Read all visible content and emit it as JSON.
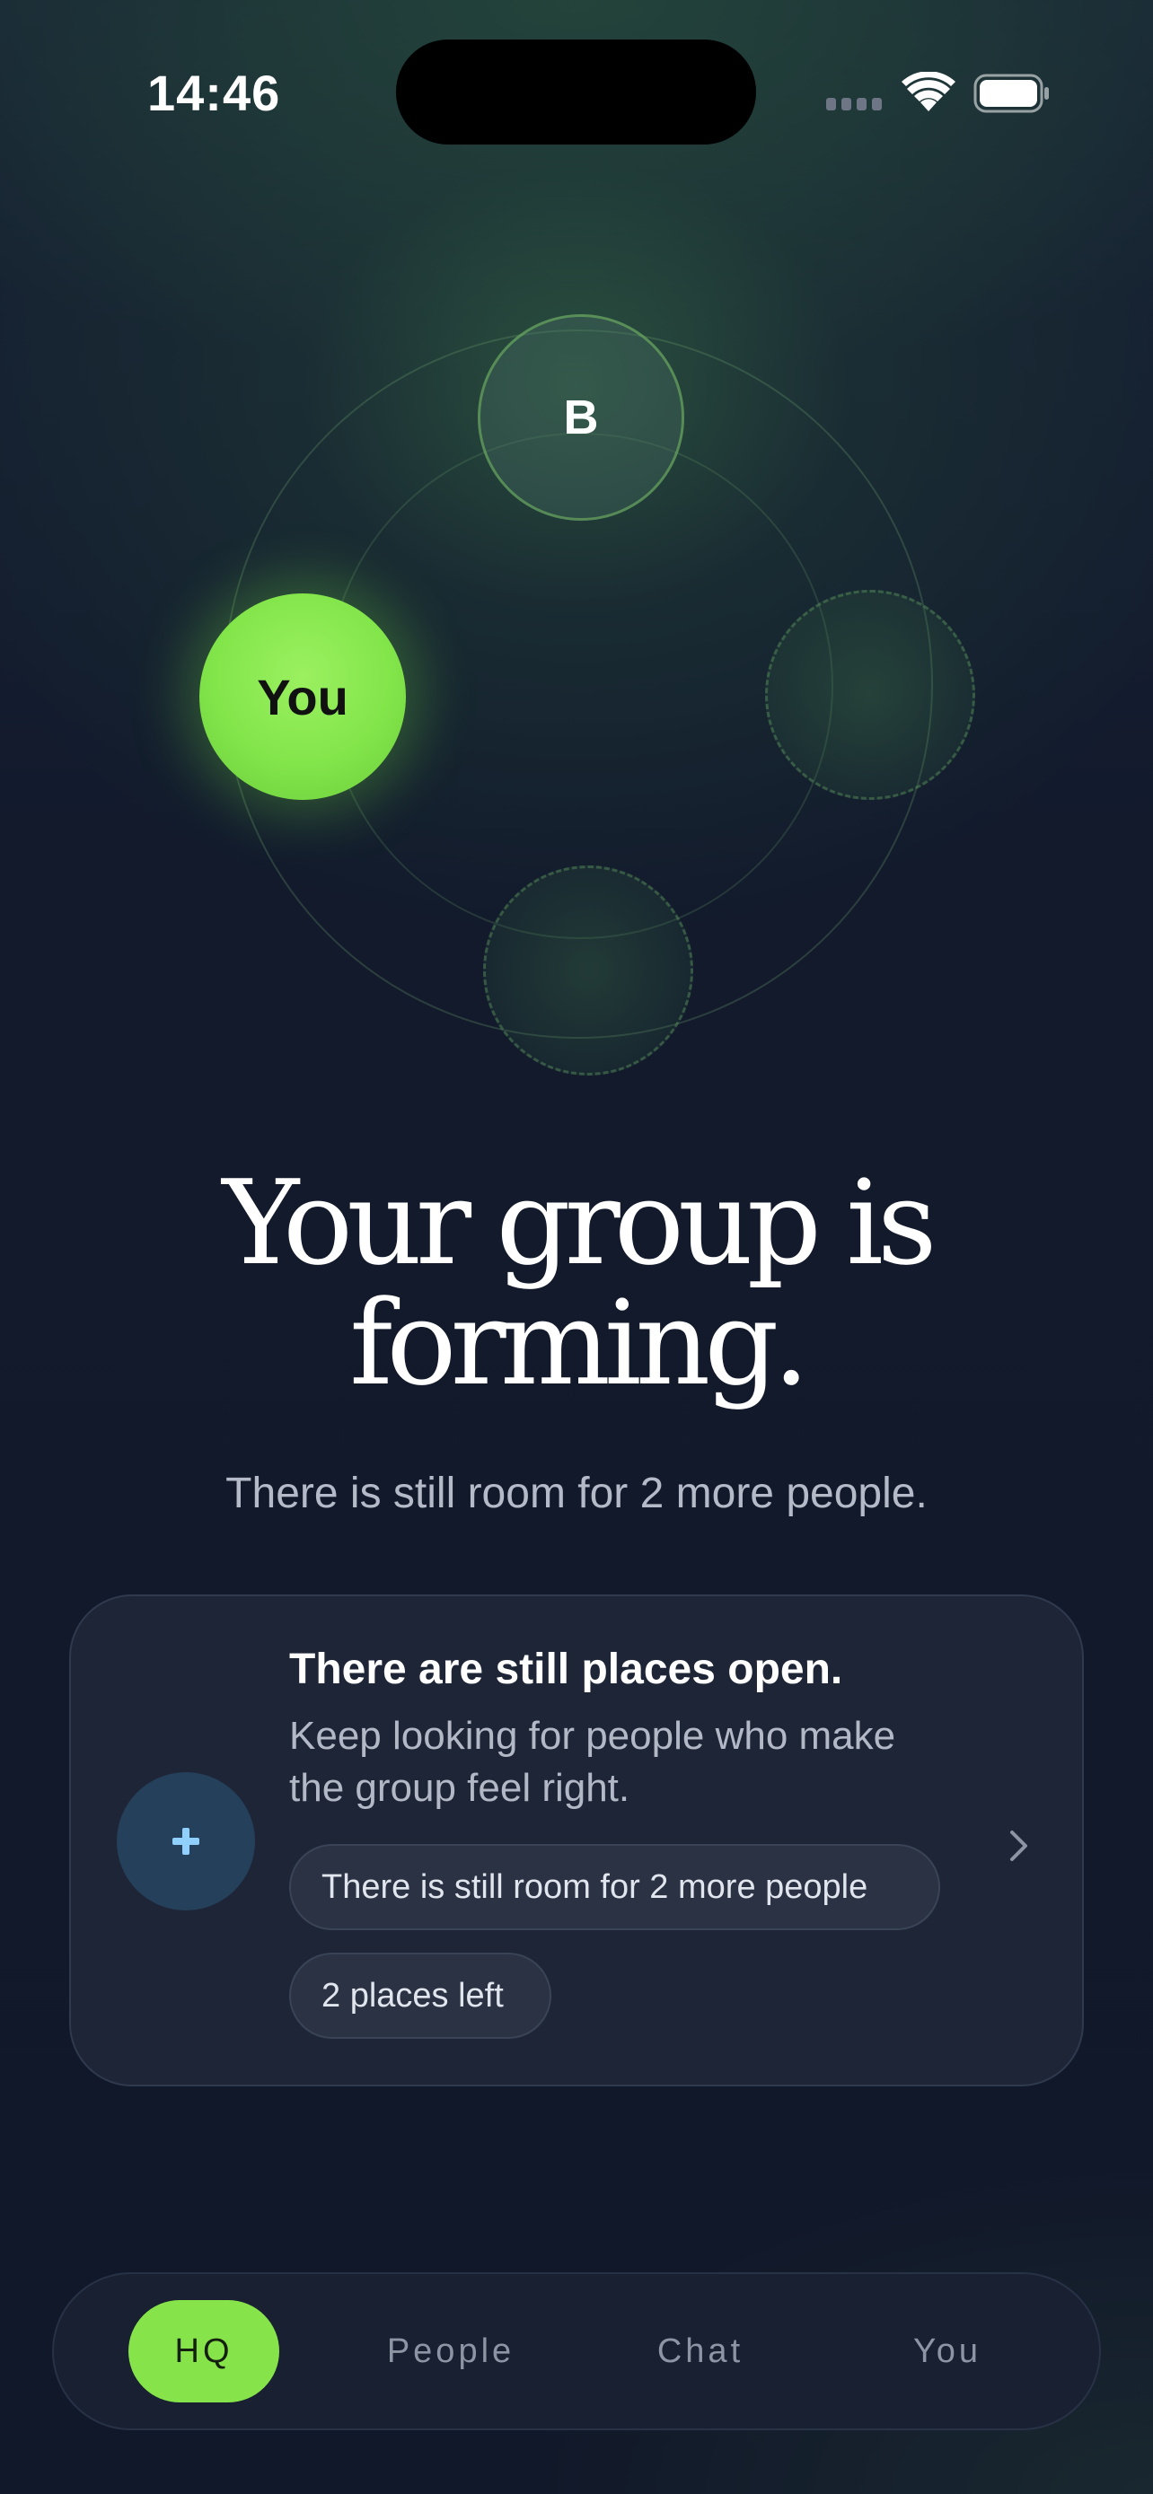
{
  "status_bar": {
    "time": "14:46",
    "icons": [
      "signal-icon",
      "wifi-icon",
      "battery-icon"
    ]
  },
  "group": {
    "members": [
      {
        "label": "B",
        "color": "#4b7a5c"
      },
      {
        "label": "You",
        "color": "#86e44a"
      }
    ],
    "open_slots": 2
  },
  "main": {
    "headline_line1": "Your group is",
    "headline_line2": "forming.",
    "subtitle": "There is still room for 2 more people."
  },
  "card": {
    "icon": "plus-icon",
    "title": "There are still places open.",
    "body": "Keep looking for people who make the group feel right.",
    "chips": [
      "There is still room for 2 more people",
      "2 places left"
    ],
    "chevron": "chevron-right-icon"
  },
  "tab_bar": {
    "tabs": [
      {
        "label": "HQ",
        "active": true
      },
      {
        "label": "People",
        "active": false
      },
      {
        "label": "Chat",
        "active": false
      },
      {
        "label": "You",
        "active": false
      }
    ]
  },
  "colors": {
    "background": "#131a2b",
    "accent": "#86e44a",
    "card": "#1e2536",
    "plus_circle": "#25405a",
    "plus_icon": "#8fd0ff"
  }
}
